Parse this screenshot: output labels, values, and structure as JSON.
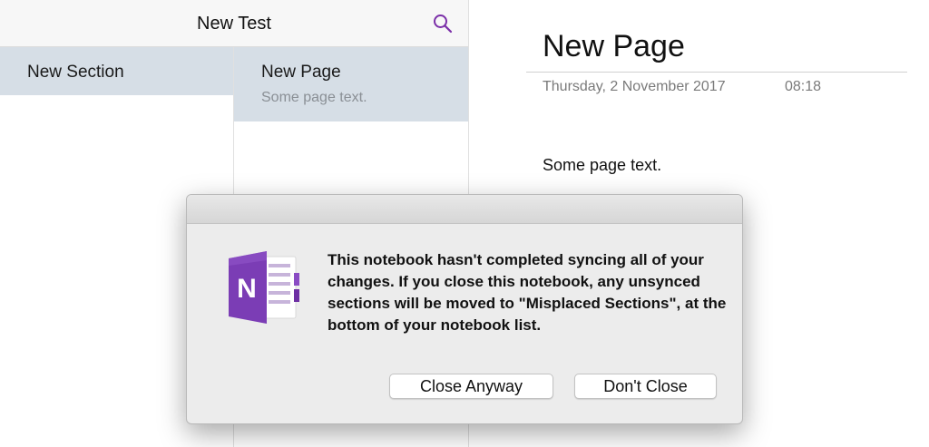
{
  "notebook": {
    "title": "New Test"
  },
  "sections": [
    {
      "label": "New Section"
    }
  ],
  "pages": [
    {
      "title": "New Page",
      "preview": "Some page text."
    }
  ],
  "page": {
    "title": "New Page",
    "date": "Thursday, 2 November 2017",
    "time": "08:18",
    "body": "Some page text."
  },
  "dialog": {
    "message": "This notebook hasn't completed syncing all of your changes. If you close this notebook, any unsynced sections will be moved to \"Misplaced Sections\", at the bottom of your notebook list.",
    "close_anyway_label": "Close Anyway",
    "dont_close_label": "Don't Close",
    "icon_letter": "N"
  },
  "icons": {
    "search": "search-icon",
    "app": "onenote-icon"
  },
  "colors": {
    "accent": "#7b2fa8",
    "selection": "#d6dee6",
    "onenote_purple": "#7b3db5"
  }
}
